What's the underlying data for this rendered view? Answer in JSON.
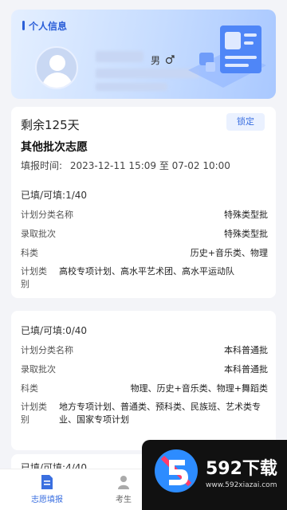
{
  "profile": {
    "title": "个人信息",
    "gender_label": "男",
    "gender_icon": "male-icon"
  },
  "main": {
    "remaining": "剩余125天",
    "lock_label": "锁定",
    "batch_title": "其他批次志愿",
    "time_label": "填报时间:",
    "time_value": "2023-12-11 15:09 至 07-02 10:00"
  },
  "sections": [
    {
      "count": "已填/可填:1/40",
      "rows": [
        {
          "k": "计划分类名称",
          "v": "特殊类型批"
        },
        {
          "k": "录取批次",
          "v": "特殊类型批"
        },
        {
          "k": "科类",
          "v": "历史+音乐类、物理"
        },
        {
          "k": "计划类别",
          "v": "高校专项计划、高水平艺术团、高水平运动队"
        }
      ]
    },
    {
      "count": "已填/可填:0/40",
      "rows": [
        {
          "k": "计划分类名称",
          "v": "本科普通批"
        },
        {
          "k": "录取批次",
          "v": "本科普通批"
        },
        {
          "k": "科类",
          "v": "物理、历史+音乐类、物理+舞蹈类"
        },
        {
          "k": "计划类别",
          "v": "地方专项计划、普通类、预科类、民族班、艺术类专业、国家专项计划"
        }
      ]
    },
    {
      "count": "已填/可填:4/40"
    }
  ],
  "tabbar": {
    "tab1": "志愿填报",
    "tab2": "考生"
  },
  "watermark": {
    "brand": "592下载",
    "site": "www.592xiazai.com"
  }
}
